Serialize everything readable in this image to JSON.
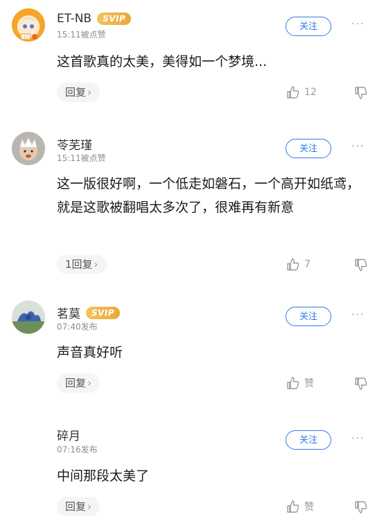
{
  "follow_label": "关注",
  "more_label": "···",
  "like_placeholder": "赞",
  "comments": [
    {
      "username": "ET-NB",
      "svip": "SVIP",
      "meta": "15:11被点赞",
      "text": "这首歌真的太美，美得如一个梦境...",
      "reply": "回复",
      "likes": "12"
    },
    {
      "username": "苓芜瑾",
      "svip": "",
      "meta": "15:11被点赞",
      "text": "这一版很好啊，一个低走如磐石，一个高开如纸鸢，就是这歌被翻唱太多次了，很难再有新意",
      "reply": "1回复",
      "likes": "7"
    },
    {
      "username": "茗莫",
      "svip": "SVIP",
      "meta": "07:40发布",
      "text": "声音真好听",
      "reply": "回复",
      "likes": "赞"
    },
    {
      "username": "碎月",
      "svip": "",
      "meta": "07:16发布",
      "text": "中间那段太美了",
      "reply": "回复",
      "likes": "赞"
    }
  ]
}
